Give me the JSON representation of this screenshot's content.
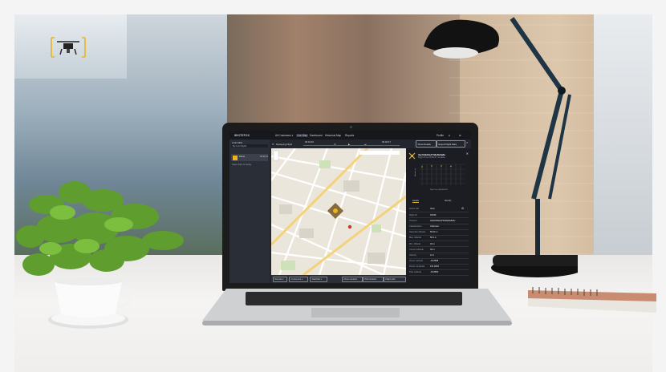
{
  "app": {
    "brand": "WHITEFOX",
    "nav": [
      {
        "label": "All Customers ▾"
      },
      {
        "label": "Live Map"
      },
      {
        "label": "Dashboard"
      },
      {
        "label": "Historical Map"
      },
      {
        "label": "Reports"
      }
    ],
    "nav_active_index": 1,
    "profile_label": "Profile"
  },
  "sidebar": {
    "header": "LIVE VIEW",
    "filter": "My Live Flights",
    "flight": {
      "name": "Drone",
      "time": "00:34:12"
    },
    "note": "Select flight to replay"
  },
  "replay": {
    "label": "Replaying Flight",
    "start_time": "00:32:40",
    "end_time": "00:36:47"
  },
  "actions": {
    "show_details": "Show Details",
    "export_flight_data": "Export Flight Data"
  },
  "panel": {
    "title": "3ac1b9d2ed743e8e9a8a",
    "subtitle": "Flight Time 00:00:47 remains",
    "tabs": [
      "Details",
      "Identify"
    ],
    "chart_y_label": "Altitude (m)",
    "chart_x_label": "Flight Time (HH:MM:SS)",
    "details": [
      {
        "k": "Drone Info",
        "v": "View"
      },
      {
        "k": "Flight ID",
        "v": "F0049"
      },
      {
        "k": "Protocol",
        "v": "3ac1b9d2ed743e8e9a8a4c"
      },
      {
        "k": "Classification",
        "v": "Unknown"
      },
      {
        "k": "Detection Altitude",
        "v": "56.00 m"
      },
      {
        "k": "Max. Altitude",
        "v": "56.2 m"
      },
      {
        "k": "Min. Altitude",
        "v": "34 m"
      },
      {
        "k": "Current Altitude",
        "v": "45 m"
      },
      {
        "k": "Velocity",
        "v": "12.1"
      },
      {
        "k": "Drone Latitude",
        "v": "-33.8688"
      },
      {
        "k": "Drone Longitude",
        "v": "151.2093"
      },
      {
        "k": "Pilot Latitude",
        "v": "-33.8650"
      }
    ]
  },
  "map_controls": [
    "Remote ▾",
    "Customers ▾",
    "Watchlist ▾",
    "Drone location",
    "Pilot location",
    "Flight path"
  ],
  "colors": {
    "accent": "#e6b422",
    "sidebar": "#2a2e36",
    "topbar": "#16181d",
    "panel": "#1b1d22"
  },
  "icons": [
    "drone-icon",
    "bell-icon",
    "gear-icon",
    "close-icon",
    "play-icon",
    "pause-icon",
    "skip-back-icon",
    "skip-forward-icon",
    "zoom-in-icon",
    "zoom-out-icon"
  ]
}
